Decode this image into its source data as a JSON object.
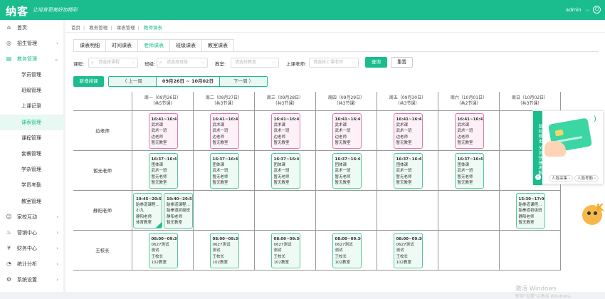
{
  "header": {
    "logo": "纳客",
    "slogan": "让培育更美好加精彩",
    "user": "admin",
    "caret": "⌵"
  },
  "sidebar": {
    "items": [
      {
        "label": "首页",
        "icon": "⌂",
        "arrow": ""
      },
      {
        "label": "招生管理",
        "icon": "◎",
        "arrow": "›"
      },
      {
        "label": "教务管理",
        "icon": "▤",
        "arrow": "⌄"
      },
      {
        "label": "家校互动",
        "icon": "☺",
        "arrow": "›"
      },
      {
        "label": "营销中心",
        "icon": "♨",
        "arrow": "›"
      },
      {
        "label": "财务中心",
        "icon": "¥",
        "arrow": "›"
      },
      {
        "label": "统计分析",
        "icon": "◔",
        "arrow": "›"
      },
      {
        "label": "系统设置",
        "icon": "⚙",
        "arrow": "›"
      }
    ],
    "sub_items": [
      "学员管理",
      "班级管理",
      "上课记录",
      "课表管理",
      "课程管理",
      "套餐管理",
      "学杂管理",
      "学员考勤",
      "教室管理"
    ]
  },
  "breadcrumb": [
    "首页",
    "教务管理",
    "课表管理",
    "教师课表"
  ],
  "tabs": [
    "课表明细",
    "时间课表",
    "老师课表",
    "班级课表",
    "教室课表"
  ],
  "filters": {
    "course_label": "课程:",
    "course_placeholder": "请选择课程",
    "class_label": "班级:",
    "class_placeholder": "请选择班级",
    "classroom_label": "教室:",
    "classroom_placeholder": "请选择教室",
    "teacher_label": "上课老师:",
    "teacher_placeholder": "请选择上课老师",
    "search_button": "查询",
    "reset_button": "重置"
  },
  "toolbar": {
    "add_button": "新增排课",
    "prev_week": "〈  上一周",
    "week_range": "09月26日 ~ 10月02日",
    "next_week": "下一周  〉"
  },
  "days": [
    {
      "name": "周一（09月26日）",
      "count": "（共5节课）"
    },
    {
      "name": "周二（09月27日）",
      "count": "（共3节课）"
    },
    {
      "name": "周三（09月28日）",
      "count": "（共3节课）"
    },
    {
      "name": "周四（09月29日）",
      "count": "（共3节课）"
    },
    {
      "name": "周五（09月30日）",
      "count": "（共3节课）"
    },
    {
      "name": "周六（10月01日）",
      "count": "（共2节课）"
    },
    {
      "name": "周日（10月02日）",
      "count": "（共3节课）"
    }
  ],
  "teachers": [
    "边老师",
    "暂无老师",
    "静阳老师",
    "王校长"
  ],
  "cards": [
    {
      "row": 0,
      "day": 0,
      "color": "pink",
      "lines": [
        "16:41~16:41",
        "武术课",
        "武术一班",
        "边老师",
        "暂无教室"
      ]
    },
    {
      "row": 0,
      "day": 1,
      "color": "pink",
      "lines": [
        "16:41~16:41",
        "武术课",
        "武术一班",
        "边老师",
        "暂无教室"
      ]
    },
    {
      "row": 0,
      "day": 2,
      "color": "pink",
      "lines": [
        "16:41~16:41",
        "武术课",
        "武术一班",
        "边老师",
        "暂无教室"
      ]
    },
    {
      "row": 0,
      "day": 3,
      "color": "pink",
      "lines": [
        "16:41~16:41",
        "武术课",
        "武术一班",
        "边老师",
        "暂无教室"
      ]
    },
    {
      "row": 0,
      "day": 4,
      "color": "pink",
      "lines": [
        "16:41~16:41",
        "武术课",
        "武术一班",
        "边老师",
        "暂无教室"
      ]
    },
    {
      "row": 0,
      "day": 5,
      "color": "pink",
      "lines": [
        "16:41~16:41",
        "武术课",
        "武术一班",
        "边老师",
        "暂无教室"
      ]
    },
    {
      "row": 1,
      "day": 0,
      "color": "green",
      "lines": [
        "16:37~16:41",
        "团体课",
        "武术一班",
        "暂无老师",
        "暂无教室"
      ]
    },
    {
      "row": 1,
      "day": 1,
      "color": "green",
      "lines": [
        "16:37~16:41",
        "团体课",
        "武术一班",
        "暂无老师",
        "暂无教室"
      ]
    },
    {
      "row": 1,
      "day": 2,
      "color": "green",
      "lines": [
        "16:37~16:41",
        "团体课",
        "武术一班",
        "暂无老师",
        "暂无教室"
      ]
    },
    {
      "row": 1,
      "day": 3,
      "color": "green",
      "lines": [
        "16:37~16:41",
        "团体课",
        "武术一班",
        "暂无老师",
        "暂无教室"
      ]
    },
    {
      "row": 1,
      "day": 4,
      "color": "green",
      "lines": [
        "16:37~16:41",
        "团体课",
        "武术一班",
        "暂无老师",
        "暂无教室"
      ]
    },
    {
      "row": 1,
      "day": 5,
      "color": "green",
      "lines": [
        "16:37~16:41",
        "团体课",
        "武术一班",
        "暂无老师",
        "暂无教室"
      ]
    },
    {
      "row": 2,
      "day": 0,
      "color": "green",
      "half": 0,
      "corner": true,
      "lines": [
        "19:45~20:59",
        "跆拳道课程…",
        "小九",
        "静阳老师",
        "体育教室"
      ]
    },
    {
      "row": 2,
      "day": 0,
      "color": "green",
      "half": 1,
      "lines": [
        "19:40~20:59",
        "跆拳道课程…",
        "跆拳道初级班",
        "静阳老师",
        "暂无教室"
      ]
    },
    {
      "row": 2,
      "day": 6,
      "color": "green",
      "lines": [
        "15:30~17:00",
        "跆拳道课程…",
        "跆拳道初级班",
        "静阳老师",
        "暂无教室"
      ]
    },
    {
      "row": 3,
      "day": 1,
      "color": "green",
      "lines": [
        "08:00~09:30",
        "0627测试",
        "测试",
        "王校长",
        "102教室"
      ]
    },
    {
      "row": 3,
      "day": 0,
      "color": "green",
      "lines": [
        "08:00~09:30",
        "0627测试",
        "测试",
        "王校长",
        "102教室"
      ]
    },
    {
      "row": 3,
      "day": 2,
      "color": "green",
      "lines": [
        "08:00~09:30",
        "0627测试",
        "测试",
        "王校长",
        "102教室"
      ]
    },
    {
      "row": 3,
      "day": 3,
      "color": "green",
      "lines": [
        "08:00~09:30",
        "0627测试",
        "测试",
        "王校长",
        "102教室"
      ]
    },
    {
      "row": 3,
      "day": 4,
      "color": "green",
      "lines": [
        "08:00~09:30",
        "0627测试",
        "测试",
        "王校长",
        "102教室"
      ]
    }
  ],
  "popup": {
    "side_text": "鼠标移出 关闭快捷考勤",
    "btn1": "人脸采集 ›",
    "btn2": "人脸考勤 ›",
    "arrow": "›"
  },
  "watermark": {
    "line1": "激活 Windows",
    "line2": "转到\"设置\"以激活 Windows。"
  },
  "mascot_text": "K"
}
